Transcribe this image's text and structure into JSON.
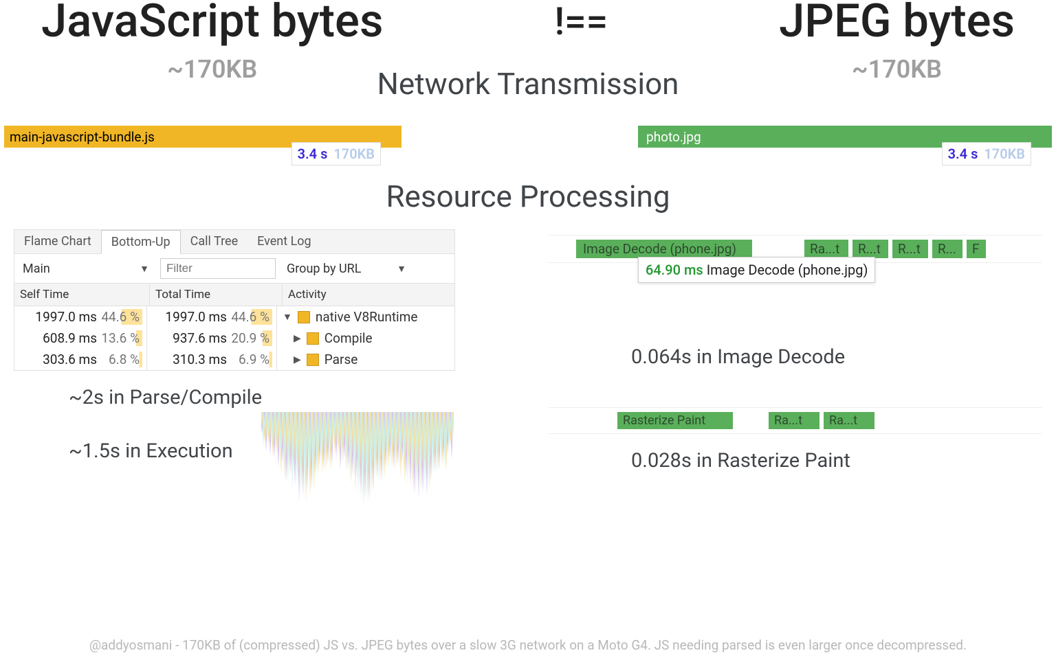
{
  "titleLeft": "JavaScript bytes",
  "neq": "!==",
  "titleRight": "JPEG bytes",
  "sizeBadge": "~170KB",
  "sectionNet": "Network Transmission",
  "sectionRes": "Resource Processing",
  "downloads": {
    "js": {
      "label": "main-javascript-bundle.js",
      "time": "3.4 s",
      "size": "170KB"
    },
    "jpg": {
      "label": "photo.jpg",
      "time": "3.4 s",
      "size": "170KB"
    }
  },
  "devtools": {
    "tabs": [
      "Flame Chart",
      "Bottom-Up",
      "Call Tree",
      "Event Log"
    ],
    "activeTab": 1,
    "threadLabel": "Main",
    "filterPlaceholder": "Filter",
    "groupByLabel": "Group by URL",
    "columns": {
      "self": "Self Time",
      "total": "Total Time",
      "activity": "Activity"
    },
    "rows": [
      {
        "selfMs": "1997.0 ms",
        "selfPct": "44.6 %",
        "selfW": "46%",
        "totalMs": "1997.0 ms",
        "totalPct": "44.6 %",
        "totalW": "46%",
        "tri": "▼",
        "act": "native V8Runtime"
      },
      {
        "selfMs": "608.9 ms",
        "selfPct": "13.6 %",
        "selfW": "14%",
        "totalMs": "937.6 ms",
        "totalPct": "20.9 %",
        "totalW": "21%",
        "tri": "▶",
        "act": "Compile"
      },
      {
        "selfMs": "303.6 ms",
        "selfPct": "6.8 %",
        "selfW": "7%",
        "totalMs": "310.3 ms",
        "totalPct": "6.9 %",
        "totalW": "7%",
        "tri": "▶",
        "act": "Parse"
      }
    ]
  },
  "js": {
    "metricParse": "~2s in Parse/Compile",
    "metricExec": "~1.5s in Execution"
  },
  "image": {
    "decodeBlocks": [
      "Image Decode (phone.jpg)",
      "Ra...t",
      "R...t",
      "R...t",
      "R...",
      "F"
    ],
    "decodeTooltipMs": "64.90 ms",
    "decodeTooltipLabel": "Image Decode (phone.jpg)",
    "metricDecode": "0.064s in Image Decode",
    "rasterBlocks": [
      "Rasterize Paint",
      "Ra...t",
      "Ra...t"
    ],
    "metricRaster": "0.028s in Rasterize Paint"
  },
  "footer": "@addyosmani - 170KB of (compressed) JS vs. JPEG bytes over a slow 3G network on a Moto G4. JS needing parsed is even larger once decompressed."
}
